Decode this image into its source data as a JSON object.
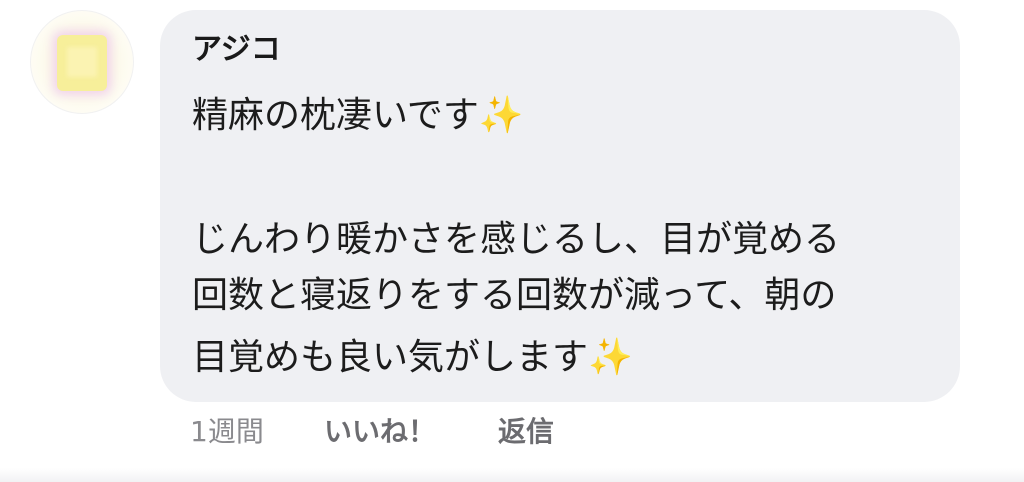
{
  "comment": {
    "author": "アジコ",
    "lines": [
      "精麻の枕凄いです✨",
      "じんわり暖かさを感じるし、目が覚める",
      "回数と寝返りをする回数が減って、朝の",
      "目覚めも良い気がします✨"
    ],
    "time": "1週間",
    "like_label": "いいね！",
    "reply_label": "返信"
  }
}
